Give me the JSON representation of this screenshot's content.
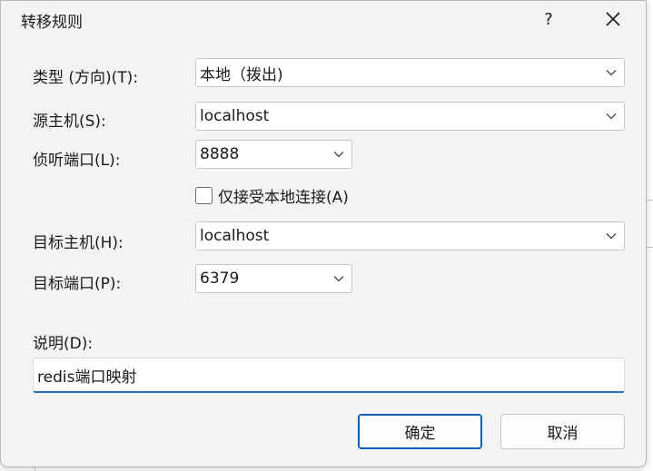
{
  "dialog": {
    "title": "转移规则",
    "help_glyph": "?",
    "close_icon": "close-icon"
  },
  "form": {
    "type_label": "类型 (方向)(T):",
    "type_value": "本地（拨出)",
    "source_host_label": "源主机(S):",
    "source_host_value": "localhost",
    "listen_port_label": "侦听端口(L):",
    "listen_port_value": "8888",
    "local_only_label": "仅接受本地连接(A)",
    "local_only_checked": false,
    "target_host_label": "目标主机(H):",
    "target_host_value": "localhost",
    "target_port_label": "目标端口(P):",
    "target_port_value": "6379",
    "description_label": "说明(D):",
    "description_value": "redis端口映射"
  },
  "buttons": {
    "ok_label": "确定",
    "cancel_label": "取消"
  },
  "colors": {
    "accent": "#0a5fb4",
    "focus_underline": "#1f6fc5",
    "dialog_bg": "#f3f3f3"
  }
}
